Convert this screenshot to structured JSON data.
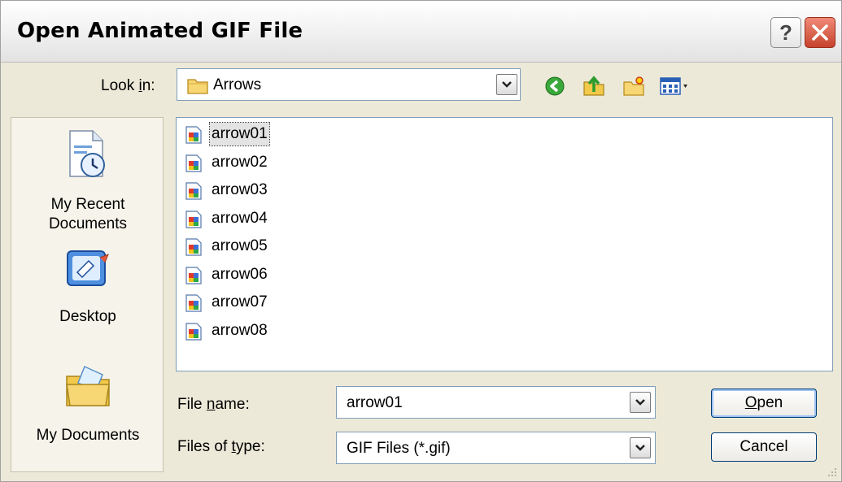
{
  "dialog": {
    "title": "Open Animated GIF File",
    "help_label": "?",
    "look_in_pre": "Look ",
    "look_in_u": "i",
    "look_in_post": "n:",
    "look_in_value": "Arrows",
    "toolbar_icons": [
      "back-icon",
      "up-folder-icon",
      "new-folder-icon",
      "views-menu-icon"
    ]
  },
  "places": [
    {
      "label_line1": "My Recent",
      "label_line2": "Documents",
      "icon": "recent-documents-icon"
    },
    {
      "label_line1": "Desktop",
      "label_line2": "",
      "icon": "desktop-icon"
    },
    {
      "label_line1": "My Documents",
      "label_line2": "",
      "icon": "my-documents-icon"
    }
  ],
  "files": [
    "arrow01",
    "arrow02",
    "arrow03",
    "arrow04",
    "arrow05",
    "arrow06",
    "arrow07",
    "arrow08"
  ],
  "selected_file": "arrow01",
  "filename": {
    "label_pre": "File ",
    "label_u": "n",
    "label_post": "ame:",
    "value": "arrow01"
  },
  "filetype": {
    "label_pre": "Files of ",
    "label_u": "t",
    "label_post": "ype:",
    "value": "GIF Files (*.gif)"
  },
  "buttons": {
    "open_u": "O",
    "open_rest": "pen",
    "cancel": "Cancel"
  },
  "colors": {
    "dialog_bg": "#ece9d8",
    "close_button": "#c6432c",
    "input_border": "#7f9db9"
  }
}
